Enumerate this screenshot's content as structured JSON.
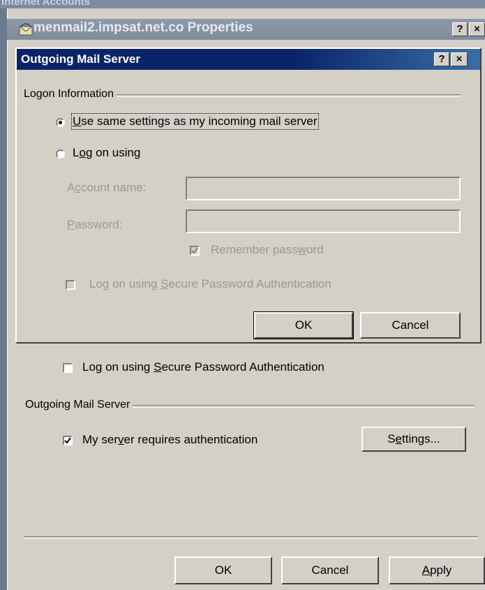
{
  "background": {
    "partial_title": "Internet Accounts"
  },
  "properties_window": {
    "title": "menmail2.impsat.net.co Properties",
    "help_button": "?",
    "close_button": "×",
    "spa_checkbox_label_pre": "Log on using ",
    "spa_checkbox_label_underlined": "S",
    "spa_checkbox_label_post": "ecure Password Authentication",
    "spa_checked": false,
    "outgoing_group_label": "Outgoing Mail Server",
    "requires_auth_pre": "My ser",
    "requires_auth_underlined": "v",
    "requires_auth_post": "er requires authentication",
    "requires_auth_checked": true,
    "settings_button_pre": "S",
    "settings_button_underlined": "e",
    "settings_button_post": "ttings...",
    "ok_button": "OK",
    "cancel_button": "Cancel",
    "apply_button_underlined": "A",
    "apply_button_post": "pply"
  },
  "outgoing_dialog": {
    "title": "Outgoing Mail Server",
    "help_button": "?",
    "close_button": "×",
    "logon_group_label": "Logon Information",
    "radio_same_underlined": "U",
    "radio_same_post": "se same settings as my incoming mail server",
    "radio_same_selected": true,
    "radio_logon_pre": "L",
    "radio_logon_underlined": "o",
    "radio_logon_post": "g on using",
    "radio_logon_selected": false,
    "account_name_label_pre": "A",
    "account_name_label_underlined": "c",
    "account_name_label_post": "count name:",
    "account_name_value": "",
    "password_label_underlined": "P",
    "password_label_post": "assword:",
    "password_value": "",
    "remember_pre": "Remember pass",
    "remember_underlined": "w",
    "remember_post": "ord",
    "remember_checked": true,
    "spa_pre": "Log on using ",
    "spa_underlined": "S",
    "spa_post": "ecure Password Authentication",
    "spa_checked": false,
    "ok_button": "OK",
    "cancel_button": "Cancel"
  },
  "colors": {
    "active_title": "#0a246a",
    "dialog_face": "#d4d0c8",
    "inactive_title": "#808b9c"
  }
}
